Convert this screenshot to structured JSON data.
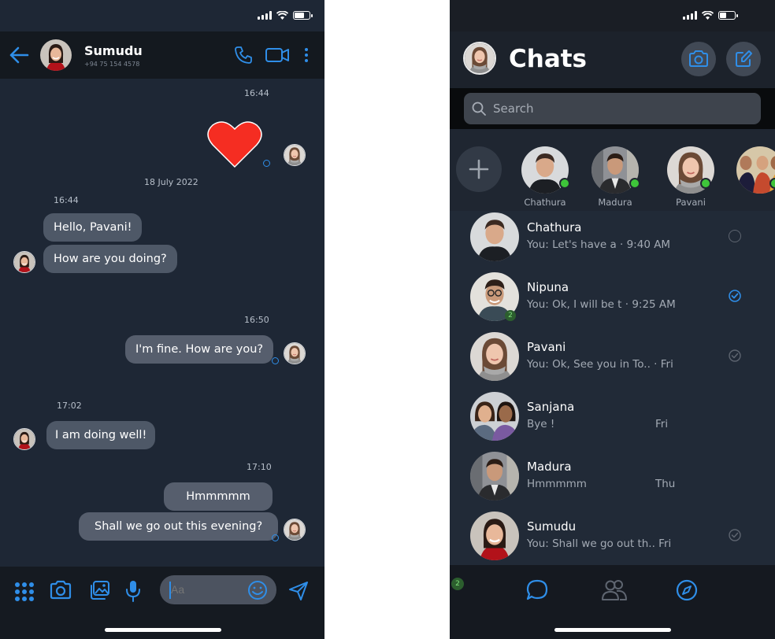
{
  "colors": {
    "accent": "#2f8ee8",
    "online": "#3ec53a",
    "heart": "#f52d22",
    "bg_chat": "#1e2735",
    "bubble": "#4e5867"
  },
  "conversation": {
    "contact_name": "Sumudu",
    "contact_phone": "+94 75 154 4578",
    "messages": [
      {
        "time": "16:44",
        "direction": "out",
        "type": "emoji",
        "emoji": "heart-emoji"
      },
      {
        "date": "18 July 2022"
      },
      {
        "time": "16:44",
        "direction": "in",
        "texts": [
          "Hello, Pavani!",
          "How are you doing?"
        ]
      },
      {
        "time": "16:50",
        "direction": "out",
        "texts": [
          "I'm fine. How are you?"
        ]
      },
      {
        "time": "17:02",
        "direction": "in",
        "texts": [
          "I am doing well!"
        ]
      },
      {
        "time": "17:10",
        "direction": "out",
        "texts": [
          "Hmmmmm",
          "Shall we go out this evening?"
        ]
      }
    ]
  },
  "composer": {
    "placeholder": "Aa"
  },
  "chats_screen": {
    "title": "Chats",
    "search_placeholder": "Search",
    "stories": [
      {
        "name": "Chathura",
        "online": true
      },
      {
        "name": "Madura",
        "online": true
      },
      {
        "name": "Pavani",
        "online": true
      },
      {
        "name": "",
        "online": true
      }
    ],
    "chats": [
      {
        "name": "Chathura",
        "preview": "You: Let's have a · 9:40 AM",
        "time": "",
        "status": "sent",
        "unread": null
      },
      {
        "name": "Nipuna",
        "preview": "You: Ok, I will be t · 9:25 AM",
        "time": "",
        "status": "delivered",
        "unread": "2"
      },
      {
        "name": "Pavani",
        "preview": "You: Ok, See you in To.. · Fri",
        "time": "",
        "status": "read",
        "unread": null
      },
      {
        "name": "Sanjana",
        "preview": "Bye !",
        "time": "Fri",
        "status": "none",
        "unread": null
      },
      {
        "name": "Madura",
        "preview": "Hmmmmm",
        "time": "Thu",
        "status": "none",
        "unread": null
      },
      {
        "name": "Sumudu",
        "preview": "You: Shall we go out th.. Fri",
        "time": "",
        "status": "read",
        "unread": null
      }
    ],
    "tab_badge": "2"
  }
}
